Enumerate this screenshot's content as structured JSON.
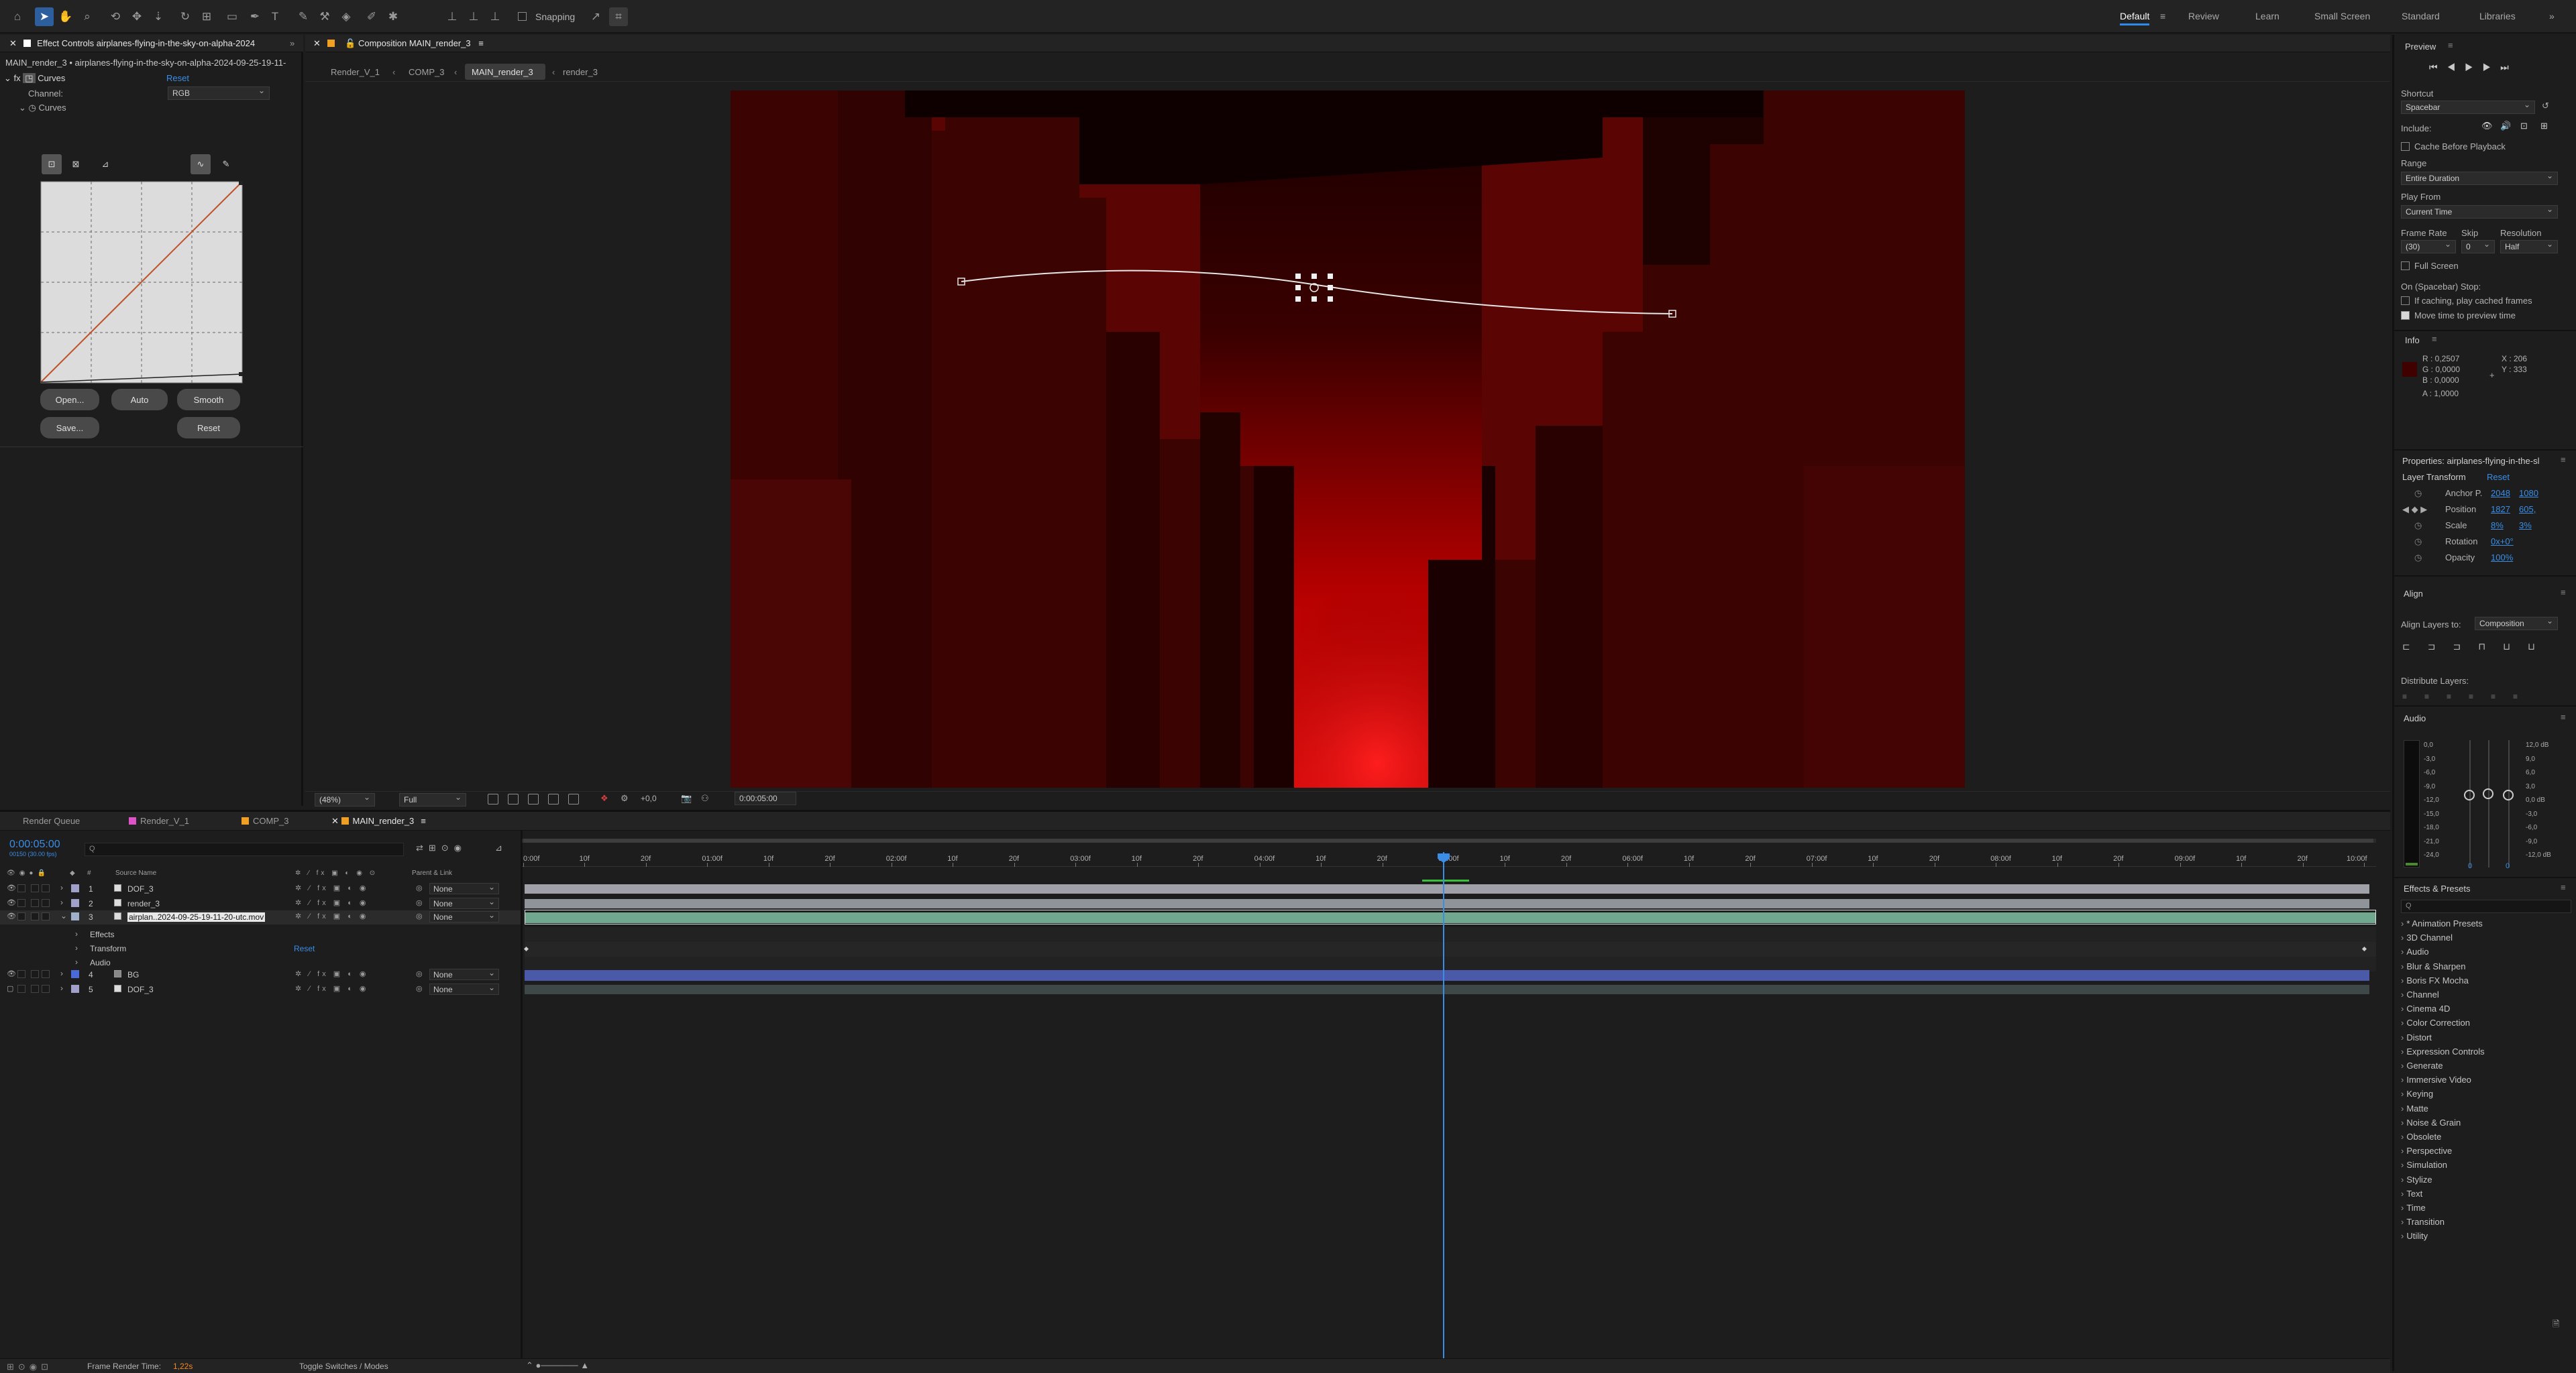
{
  "toolbar": {
    "snapping_label": "Snapping",
    "workspaces": [
      "Default",
      "Review",
      "Learn",
      "Small Screen",
      "Standard",
      "Libraries"
    ]
  },
  "effect_controls": {
    "tab_title": "Effect Controls airplanes-flying-in-the-sky-on-alpha-2024",
    "layer_path": "MAIN_render_3 • airplanes-flying-in-the-sky-on-alpha-2024-09-25-19-11-",
    "effect_name": "Curves",
    "reset_label": "Reset",
    "channel_label": "Channel:",
    "channel_value": "RGB",
    "curves_sub": "Curves",
    "buttons": {
      "open": "Open...",
      "auto": "Auto",
      "smooth": "Smooth",
      "save": "Save...",
      "reset": "Reset"
    }
  },
  "composition": {
    "tab_title": "Composition MAIN_render_3",
    "breadcrumbs": [
      "Render_V_1",
      "COMP_3",
      "MAIN_render_3",
      "render_3"
    ],
    "zoom": "(48%)",
    "resolution": "Full",
    "exposure": "+0,0",
    "timecode": "0:00:05:00"
  },
  "timeline": {
    "tabs": [
      {
        "label": "Render Queue",
        "color": ""
      },
      {
        "label": "Render_V_1",
        "color": "#e052c8"
      },
      {
        "label": "COMP_3",
        "color": "#f0a020"
      },
      {
        "label": "MAIN_render_3",
        "color": "#f0a020"
      }
    ],
    "current_time": "0:00:05:00",
    "fps_note": "00150 (30.00 fps)",
    "search_placeholder": "Q",
    "col_source": "Source Name",
    "col_parent": "Parent & Link",
    "layers": [
      {
        "num": "1",
        "name": "DOF_3",
        "parent": "None",
        "color": "#a0a0c8"
      },
      {
        "num": "2",
        "name": "render_3",
        "parent": "None",
        "color": "#a0a0c8"
      },
      {
        "num": "3",
        "name": "airplan..2024-09-25-19-11-20-utc.mov",
        "parent": "None",
        "color": "#a0b0c8"
      },
      {
        "num": "4",
        "name": "BG",
        "parent": "None",
        "color": "#4a6ad8"
      },
      {
        "num": "5",
        "name": "DOF_3",
        "parent": "None",
        "color": "#a0a0c8"
      }
    ],
    "sub_rows": {
      "effects": "Effects",
      "transform": "Transform",
      "transform_reset": "Reset",
      "audio": "Audio"
    },
    "ruler": [
      "0:00f",
      "10f",
      "20f",
      "01:00f",
      "10f",
      "20f",
      "02:00f",
      "10f",
      "20f",
      "03:00f",
      "10f",
      "20f",
      "04:00f",
      "10f",
      "20f",
      "05:00f",
      "10f",
      "20f",
      "06:00f",
      "10f",
      "20f",
      "07:00f",
      "10f",
      "20f",
      "08:00f",
      "10f",
      "20f",
      "09:00f",
      "10f",
      "20f",
      "10:00f"
    ],
    "render_time_label": "Frame Render Time:",
    "render_time_value": "1,22s",
    "toggle_label": "Toggle Switches / Modes"
  },
  "preview": {
    "title": "Preview",
    "shortcut_label": "Shortcut",
    "shortcut_value": "Spacebar",
    "include_label": "Include:",
    "cache_label": "Cache Before Playback",
    "range_label": "Range",
    "range_value": "Entire Duration",
    "play_from_label": "Play From",
    "play_from_value": "Current Time",
    "frame_rate_label": "Frame Rate",
    "skip_label": "Skip",
    "resolution_label": "Resolution",
    "frame_rate_value": "(30)",
    "skip_value": "0",
    "resolution_value": "Half",
    "full_screen_label": "Full Screen",
    "stop_label": "On (Spacebar) Stop:",
    "if_caching_label": "If caching, play cached frames",
    "move_time_label": "Move time to preview time"
  },
  "info": {
    "title": "Info",
    "r": "R : 0,2507",
    "g": "G : 0,0000",
    "b": "B : 0,0000",
    "a": "A : 1,0000",
    "x": "X : 206",
    "y": "Y : 333"
  },
  "properties": {
    "title": "Properties: airplanes-flying-in-the-sl",
    "layer_transform": "Layer Transform",
    "reset": "Reset",
    "anchor_label": "Anchor P.",
    "anchor_x": "2048",
    "anchor_y": "1080",
    "position_label": "Position",
    "position_x": "1827",
    "position_y": "605,",
    "scale_label": "Scale",
    "scale_x": "8%",
    "scale_y": "3%",
    "rotation_label": "Rotation",
    "rotation_value": "0x+0°",
    "opacity_label": "Opacity",
    "opacity_value": "100%"
  },
  "align": {
    "title": "Align",
    "align_to_label": "Align Layers to:",
    "align_to_value": "Composition",
    "distribute_label": "Distribute Layers:"
  },
  "audio": {
    "title": "Audio",
    "left_scale": [
      "0,0",
      "-3,0",
      "-6,0",
      "-9,0",
      "-12,0",
      "-15,0",
      "-18,0",
      "-21,0",
      "-24,0"
    ],
    "right_scale": [
      "12,0 dB",
      "9,0",
      "6,0",
      "3,0",
      "0,0 dB",
      "-3,0",
      "-6,0",
      "-9,0",
      "-12,0 dB"
    ],
    "zero_left": "0",
    "zero_right": "0"
  },
  "effects_presets": {
    "title": "Effects & Presets",
    "search_placeholder": "Q",
    "items": [
      "* Animation Presets",
      "3D Channel",
      "Audio",
      "Blur & Sharpen",
      "Boris FX Mocha",
      "Channel",
      "Cinema 4D",
      "Color Correction",
      "Distort",
      "Expression Controls",
      "Generate",
      "Immersive Video",
      "Keying",
      "Matte",
      "Noise & Grain",
      "Obsolete",
      "Perspective",
      "Simulation",
      "Stylize",
      "Text",
      "Time",
      "Transition",
      "Utility"
    ]
  }
}
